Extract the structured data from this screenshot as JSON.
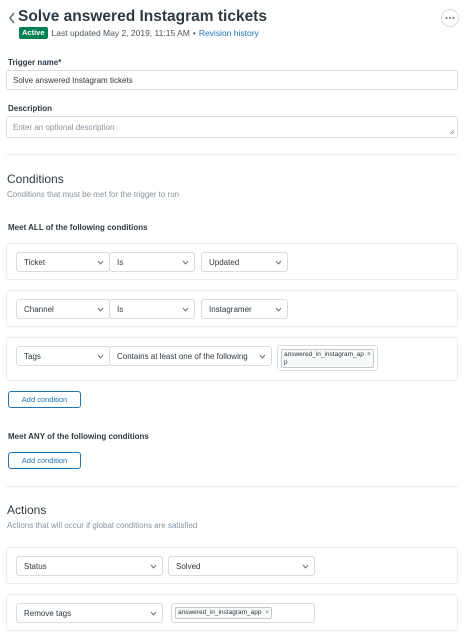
{
  "header": {
    "title": "Solve answered Instagram tickets",
    "status_badge": "Active",
    "last_updated": "Last updated May 2, 2019, 11:15 AM",
    "separator": "•",
    "revision_link": "Revision history"
  },
  "form": {
    "trigger_name_label": "Trigger name*",
    "trigger_name_value": "Solve answered Instagram tickets",
    "description_label": "Description",
    "description_placeholder": "Enter an optional description"
  },
  "conditions": {
    "title": "Conditions",
    "subtitle": "Conditions that must be met for the trigger to run",
    "all_label": "Meet ALL of the following conditions",
    "rows": [
      {
        "field": "Ticket",
        "operator": "Is",
        "value": "Updated"
      },
      {
        "field": "Channel",
        "operator": "Is",
        "value": "Instagramer"
      },
      {
        "field": "Tags",
        "operator": "Contains at least one of the following",
        "tag_line1": "answered_in_instagram_ap",
        "tag_line2": "p"
      }
    ],
    "add_condition_label": "Add condition",
    "any_label": "Meet ANY of the following conditions",
    "add_condition_any_label": "Add condition"
  },
  "actions": {
    "title": "Actions",
    "subtitle": "Actions that will occur if global conditions are satisfied",
    "rows": [
      {
        "field": "Status",
        "value": "Solved"
      },
      {
        "field": "Remove tags",
        "tag": "answered_in_instagram_app"
      }
    ]
  },
  "icons": {
    "back": "chevron-left-icon",
    "more": "more-horizontal-icon",
    "dropdown": "chevron-down-icon",
    "remove": "close-icon",
    "resize": "resize-handle-icon"
  },
  "colors": {
    "accent": "#1f73b7",
    "active_badge": "#038153",
    "text": "#2f3941",
    "muted": "#87929d",
    "border": "#d8dcde"
  }
}
